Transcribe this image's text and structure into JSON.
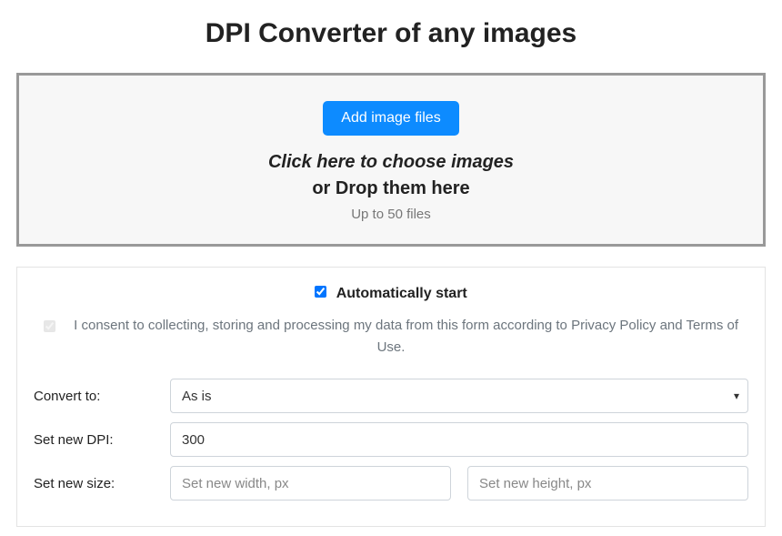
{
  "title": "DPI Converter of any images",
  "dropzone": {
    "button_label": "Add image files",
    "line1": "Click here to choose images",
    "line2": "or Drop them here",
    "line3": "Up to 50 files"
  },
  "settings": {
    "auto_start_label": "Automatically start",
    "auto_start_checked": true,
    "consent_text": "I consent to collecting, storing and processing my data from this form according to Privacy Policy and Terms of Use.",
    "consent_checked": true,
    "convert_label": "Convert to:",
    "convert_value": "As is",
    "dpi_label": "Set new DPI:",
    "dpi_value": "300",
    "size_label": "Set new size:",
    "width_placeholder": "Set new width, px",
    "height_placeholder": "Set new height, px"
  }
}
